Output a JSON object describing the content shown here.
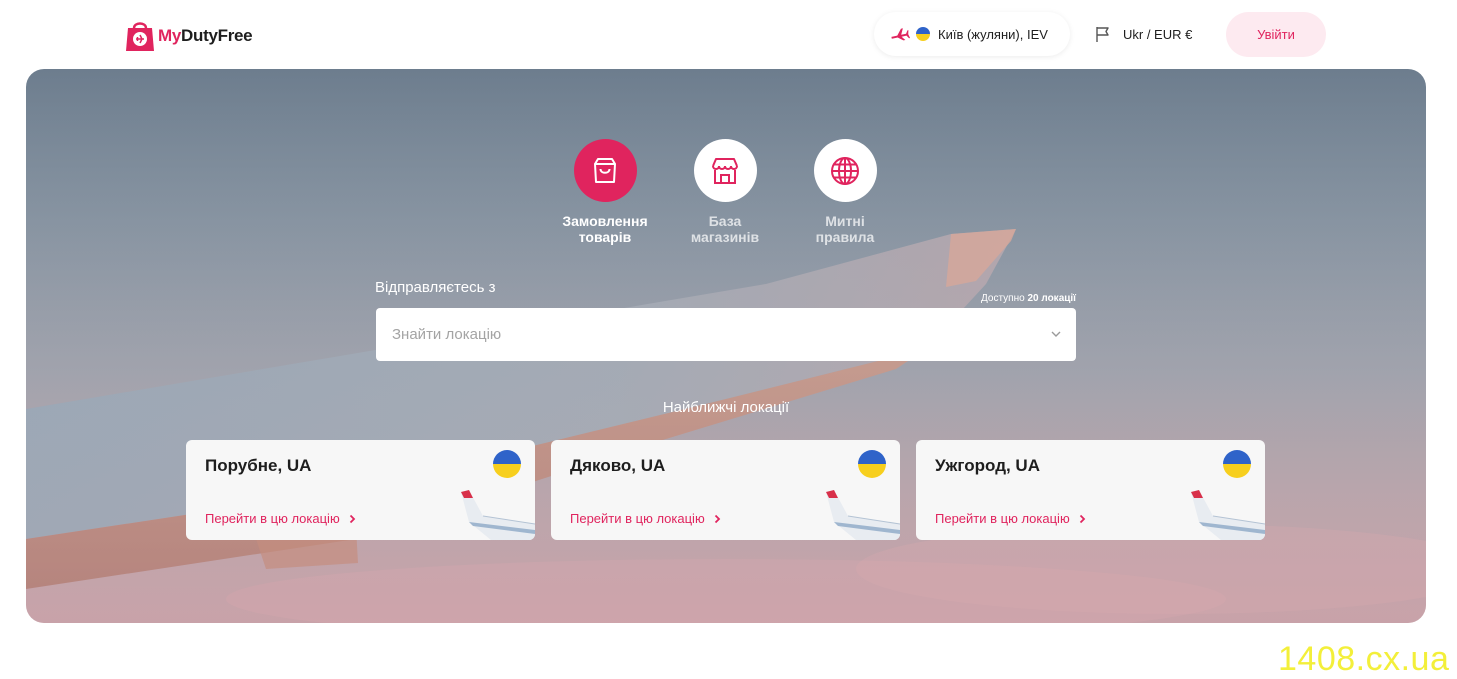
{
  "header": {
    "logo_my": "My",
    "logo_rest": "DutyFree",
    "location": "Київ (жуляни), IEV",
    "language": "Ukr / EUR €",
    "login_label": "Увійти"
  },
  "nav": {
    "items": [
      {
        "line1": "Замовлення",
        "line2": "товарів",
        "icon": "shopping-bag-icon",
        "active": true
      },
      {
        "line1": "База",
        "line2": "магазинів",
        "icon": "store-icon",
        "active": false
      },
      {
        "line1": "Митні",
        "line2": "правила",
        "icon": "globe-icon",
        "active": false
      }
    ]
  },
  "search": {
    "label": "Відправляєтесь з",
    "available_prefix": "Доступно",
    "available_count": "20 локації",
    "placeholder": "Знайти локацію"
  },
  "nearest": {
    "title": "Найближчі локації",
    "cards": [
      {
        "city": "Порубне, UA",
        "link": "Перейти в цю локацію"
      },
      {
        "city": "Дяково, UA",
        "link": "Перейти в цю локацію"
      },
      {
        "city": "Ужгород, UA",
        "link": "Перейти в цю локацію"
      }
    ]
  },
  "watermark": "1408.cx.ua",
  "colors": {
    "accent": "#e0245e",
    "accent_light": "#fdeaf0",
    "flag_blue": "#2f63c9",
    "flag_yellow": "#f7cf1e"
  }
}
